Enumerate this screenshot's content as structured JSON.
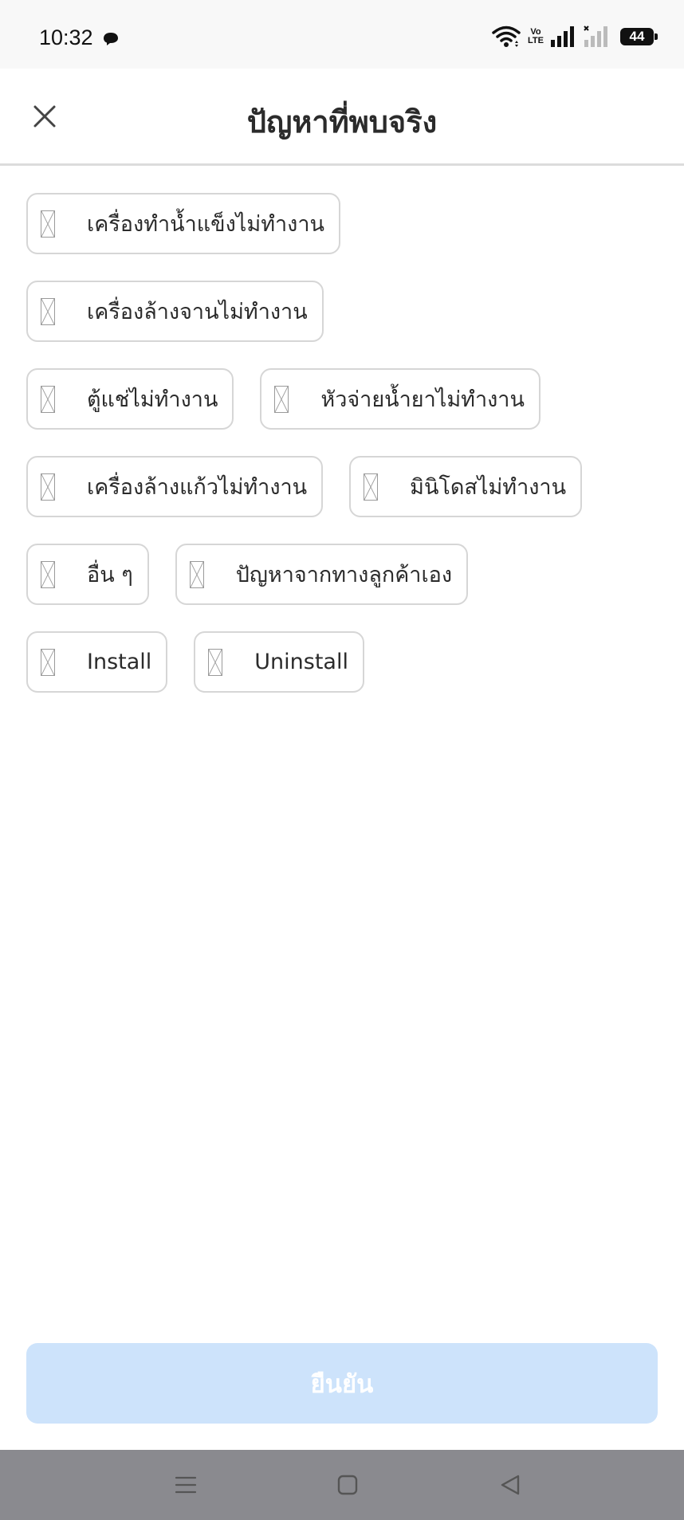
{
  "status_bar": {
    "time": "10:32",
    "volte_line1": "Vo",
    "volte_line2": "LTE",
    "battery": "44"
  },
  "header": {
    "title": "ปัญหาที่พบจริง",
    "close_icon": "close-icon"
  },
  "options": [
    [
      "เครื่องทำน้ำแข็งไม่ทำงาน"
    ],
    [
      "เครื่องล้างจานไม่ทำงาน"
    ],
    [
      "ตู้แช่ไม่ทำงาน",
      "หัวจ่ายน้ำยาไม่ทำงาน"
    ],
    [
      "เครื่องล้างแก้วไม่ทำงาน",
      "มินิโดสไม่ทำงาน"
    ],
    [
      "อื่น ๆ",
      "ปัญหาจากทางลูกค้าเอง"
    ],
    [
      "Install",
      "Uninstall"
    ]
  ],
  "confirm": {
    "label": "ยืนยัน",
    "bg_color": "#cde3fb",
    "text_color": "#ffffff"
  },
  "nav_bar": {
    "icons": [
      "menu-icon",
      "home-icon",
      "back-icon"
    ]
  }
}
